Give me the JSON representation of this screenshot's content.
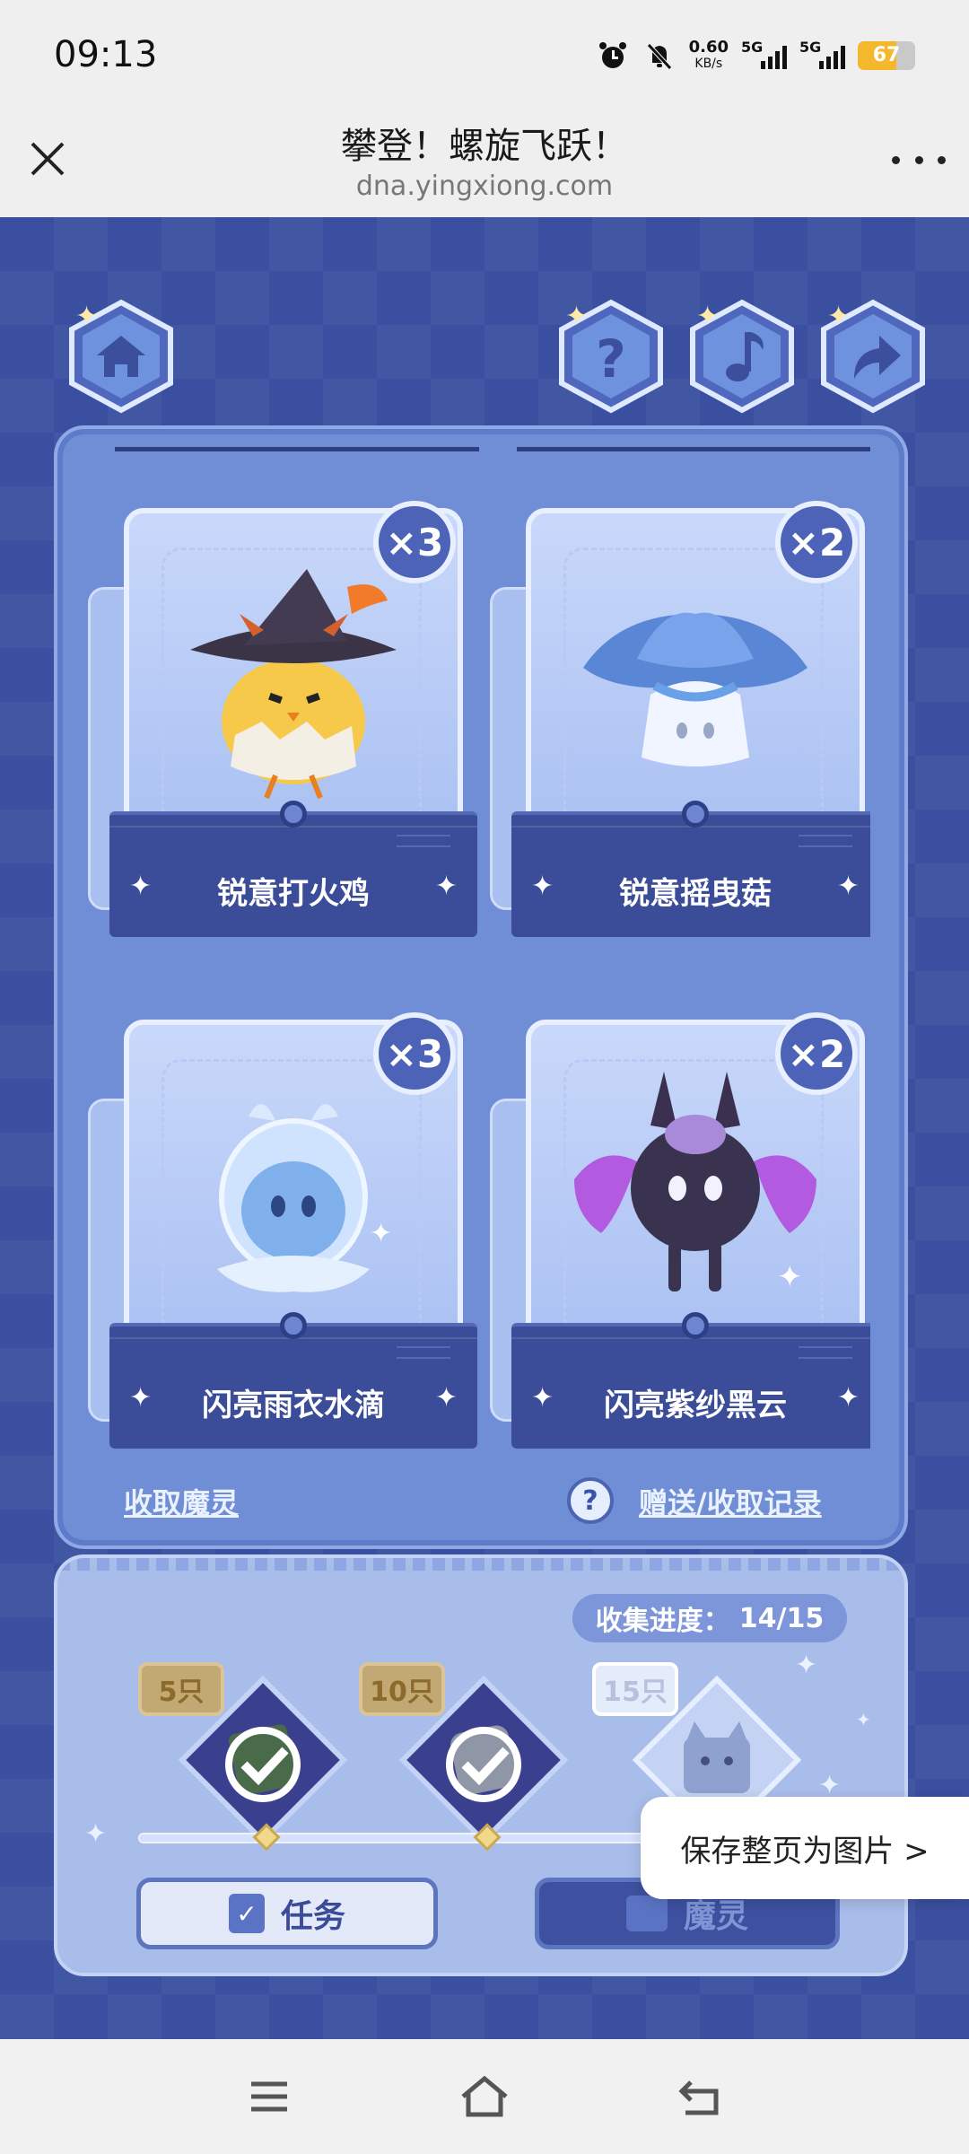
{
  "status_bar": {
    "time": "09:13",
    "net_speed": "0.60",
    "net_unit": "KB/s",
    "sim1": "5G",
    "sim2": "5G",
    "battery": "67",
    "battery_level": 0.67
  },
  "browser": {
    "title": "攀登！螺旋飞跃！",
    "url": "dna.yingxiong.com"
  },
  "cards": [
    {
      "name": "锐意打火鸡",
      "count": "×3",
      "art": "chick-witch-hat-art"
    },
    {
      "name": "锐意摇曳菇",
      "count": "×2",
      "art": "blue-mushroom-art"
    },
    {
      "name": "闪亮雨衣水滴",
      "count": "×3",
      "art": "raincoat-droplet-art"
    },
    {
      "name": "闪亮紫纱黑云",
      "count": "×2",
      "art": "purple-veil-cloud-art"
    }
  ],
  "links": {
    "collect": "收取魔灵",
    "record": "赠送/收取记录",
    "help_glyph": "?"
  },
  "progress": {
    "label": "收集进度：",
    "value": "14/15",
    "fraction": 0.93
  },
  "milestones": [
    {
      "tag": "5只",
      "claimed": true
    },
    {
      "tag": "10只",
      "claimed": true
    },
    {
      "tag": "15只",
      "claimed": false
    }
  ],
  "buttons": {
    "task": "任务",
    "spirit": "魔灵"
  },
  "toast": {
    "save_page": "保存整页为图片 >"
  },
  "colors": {
    "panel": "#6f8ed6",
    "pocket": "#3b4c98",
    "badge": "#4d63b8",
    "gold_tag": "#c2a872"
  }
}
